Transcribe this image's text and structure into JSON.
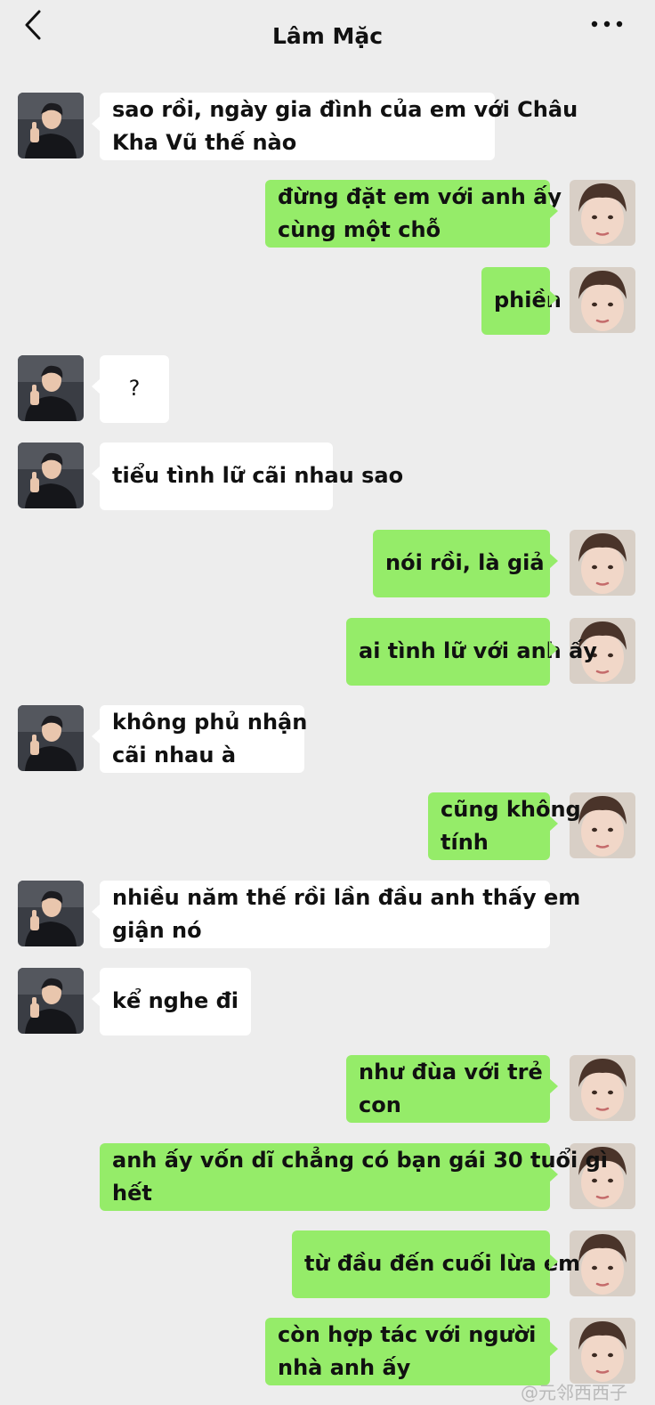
{
  "header": {
    "title": "Lâm Mặc",
    "back_icon": "chevron-left-icon",
    "more_icon": "more-dots-icon"
  },
  "colors": {
    "background": "#ededed",
    "self_bubble": "#95ec69",
    "other_bubble": "#ffffff"
  },
  "messages": [
    {
      "from": "other",
      "lines": [
        "sao rồi, ngày gia đình của em với Châu",
        "Kha Vũ thế nào"
      ]
    },
    {
      "from": "self",
      "lines": [
        "đừng đặt em với anh ấy",
        "cùng một chỗ"
      ]
    },
    {
      "from": "self",
      "lines": [
        "phiền"
      ]
    },
    {
      "from": "other",
      "lines": [
        "?"
      ]
    },
    {
      "from": "other",
      "lines": [
        "tiểu tình lữ cãi nhau sao"
      ]
    },
    {
      "from": "self",
      "lines": [
        "nói rồi, là giả"
      ]
    },
    {
      "from": "self",
      "lines": [
        "ai tình lữ với anh ấy"
      ]
    },
    {
      "from": "other",
      "lines": [
        "không phủ nhận",
        "cãi nhau à"
      ]
    },
    {
      "from": "self",
      "lines": [
        "cũng không",
        "tính"
      ]
    },
    {
      "from": "other",
      "lines": [
        "nhiều năm thế rồi lần đầu anh thấy em",
        "giận nó"
      ]
    },
    {
      "from": "other",
      "lines": [
        "kể nghe đi"
      ]
    },
    {
      "from": "self",
      "lines": [
        "như đùa với trẻ",
        "con"
      ]
    },
    {
      "from": "self",
      "lines": [
        "anh ấy vốn dĩ chẳng có bạn gái 30 tuổi gì",
        "hết"
      ]
    },
    {
      "from": "self",
      "lines": [
        "từ đầu đến cuối lừa em"
      ]
    },
    {
      "from": "self",
      "lines": [
        "còn hợp tác với người",
        "nhà anh ấy"
      ]
    }
  ],
  "watermark": "@元邻西西子"
}
